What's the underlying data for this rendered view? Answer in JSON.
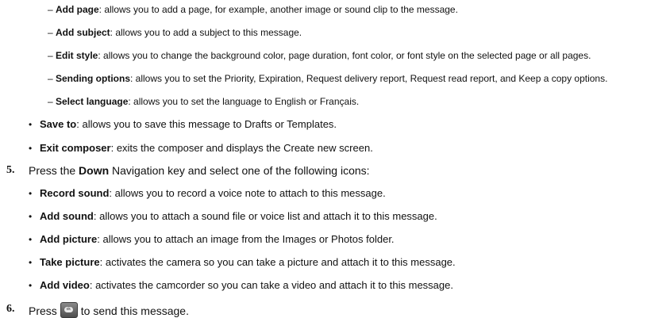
{
  "sub_options": [
    {
      "term": "Add page",
      "desc": ": allows you to add a page, for example, another image or sound clip to the message."
    },
    {
      "term": "Add subject",
      "desc": ": allows you to add a subject to this message."
    },
    {
      "term": "Edit style",
      "desc": ": allows you to change the background color, page duration, font color, or font style on the selected page or all pages."
    },
    {
      "term": "Sending options",
      "desc": ": allows you to set the Priority, Expiration, Request delivery report, Request read report, and Keep a copy options."
    },
    {
      "term": "Select language",
      "desc": ": allows you to set the language to English or Français."
    }
  ],
  "options": [
    {
      "term": "Save to",
      "desc": ": allows you to save this message to Drafts or Templates."
    },
    {
      "term": "Exit composer",
      "desc": ": exits the composer and displays the Create new screen."
    }
  ],
  "step5": {
    "number": "5.",
    "pre": "Press the ",
    "key": "Down",
    "post": " Navigation key and select one of the following icons:"
  },
  "icons": [
    {
      "term": "Record sound",
      "desc": ": allows you to record a voice note to attach to this message."
    },
    {
      "term": "Add sound",
      "desc": ": allows you to attach a sound file or voice list and attach it to this message."
    },
    {
      "term": "Add picture",
      "desc": ": allows you to attach an image from the Images or Photos folder."
    },
    {
      "term": "Take picture",
      "desc": ": activates the camera so you can take a picture and attach it to this message."
    },
    {
      "term": "Add video",
      "desc": ": activates the camcorder so you can take a video and attach it to this message."
    }
  ],
  "step6": {
    "number": "6.",
    "pre": "Press",
    "key_label": "ok",
    "post": "to send this message."
  },
  "dash_char": "–",
  "bullet_char": "•"
}
